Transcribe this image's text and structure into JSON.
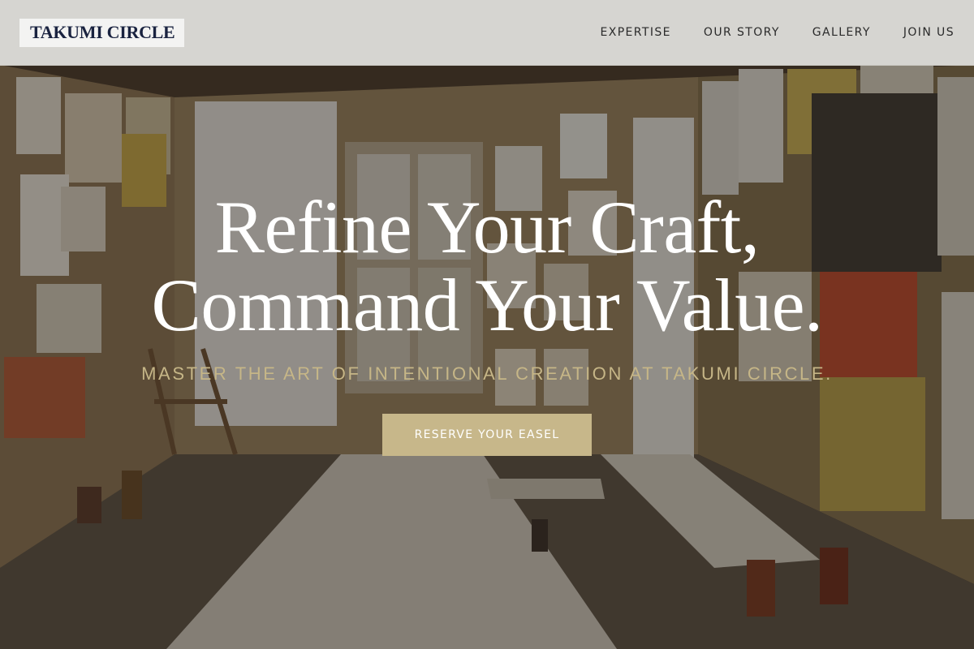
{
  "brand": {
    "name": "TAKUMI CIRCLE"
  },
  "nav": {
    "items": [
      {
        "label": "EXPERTISE"
      },
      {
        "label": "OUR STORY"
      },
      {
        "label": "GALLERY"
      },
      {
        "label": "JOIN US"
      }
    ]
  },
  "hero": {
    "title_line_1": "Refine Your Craft,",
    "title_line_2": "Command Your Value.",
    "subtitle": "MASTER THE ART OF INTENTIONAL CREATION AT TAKUMI CIRCLE.",
    "cta_label": "RESERVE YOUR EASEL",
    "background": "art-studio-photo"
  },
  "colors": {
    "header_bg": "#dedcd8",
    "brand_text": "#1a2340",
    "accent_gold": "#c7b78a",
    "subtitle_gold": "#c6b687",
    "title_white": "#ffffff"
  }
}
